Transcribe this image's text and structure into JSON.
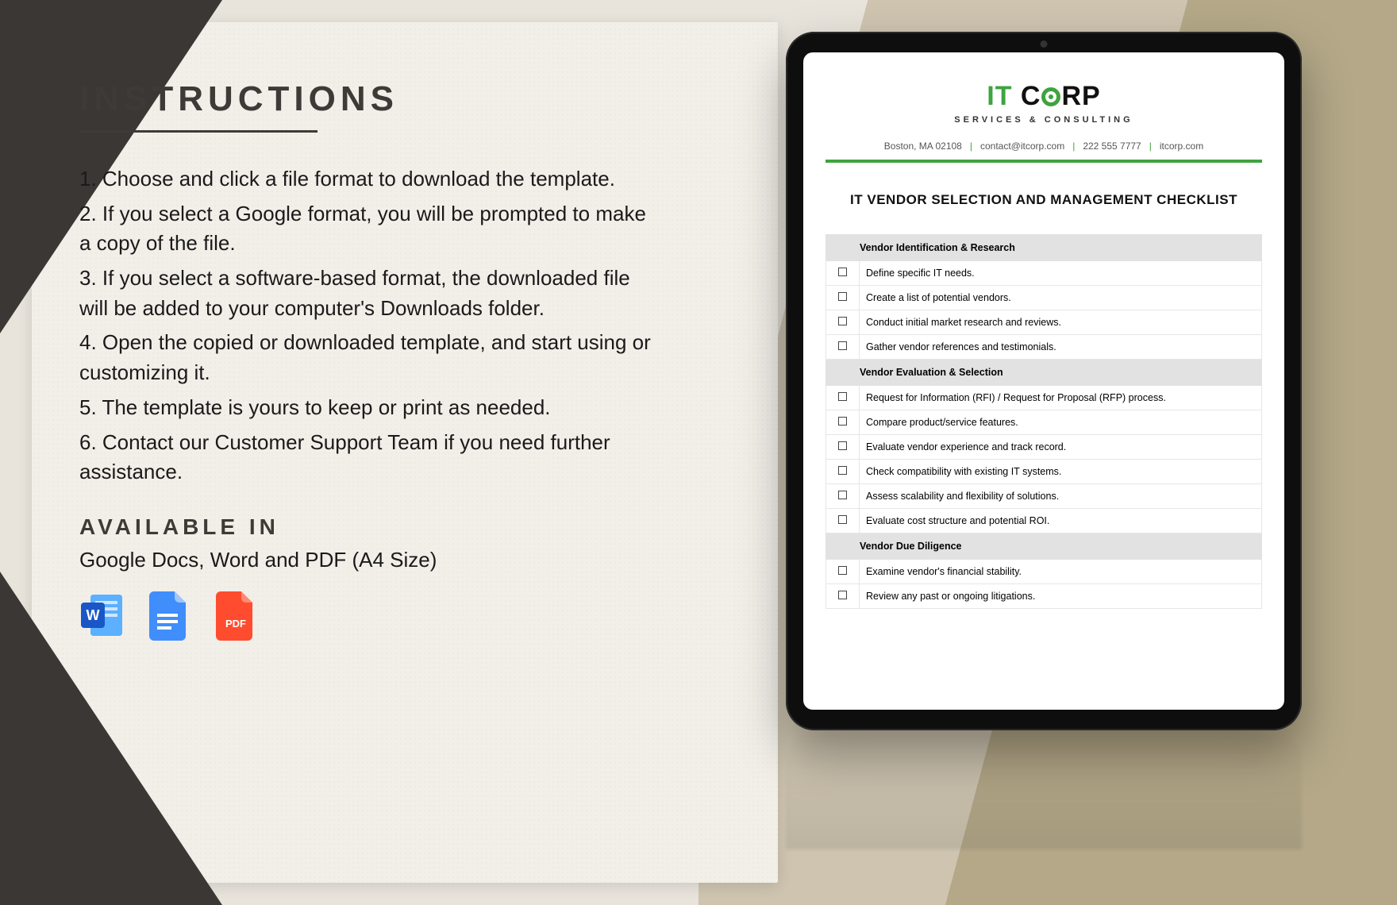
{
  "left": {
    "heading": "INSTRUCTIONS",
    "steps": [
      "1. Choose and click a file format to download the template.",
      "2. If you select a Google format, you will be prompted to make a copy of the file.",
      "3. If you select a software-based format, the downloaded file will be added to your computer's Downloads folder.",
      "4. Open the copied or downloaded template, and start using or customizing it.",
      "5. The template is yours to keep or print as needed.",
      "6. Contact our Customer Support Team if you need further assistance."
    ],
    "available_heading": "AVAILABLE IN",
    "available_text": "Google Docs, Word and PDF (A4 Size)",
    "pdf_label": "PDF"
  },
  "doc": {
    "brand_it": "IT",
    "brand_corp": "CORP",
    "tagline": "SERVICES & CONSULTING",
    "contact_city": "Boston, MA 02108",
    "contact_email": "contact@itcorp.com",
    "contact_phone": "222 555 7777",
    "contact_site": "itcorp.com",
    "title": "IT VENDOR SELECTION AND MANAGEMENT CHECKLIST",
    "sections": [
      {
        "name": "Vendor Identification & Research",
        "items": [
          "Define specific IT needs.",
          "Create a list of potential vendors.",
          "Conduct initial market research and reviews.",
          "Gather vendor references and testimonials."
        ]
      },
      {
        "name": "Vendor Evaluation & Selection",
        "items": [
          "Request for Information (RFI) / Request for Proposal (RFP) process.",
          "Compare product/service features.",
          "Evaluate vendor experience and track record.",
          "Check compatibility with existing IT systems.",
          "Assess scalability and flexibility of solutions.",
          "Evaluate cost structure and potential ROI."
        ]
      },
      {
        "name": "Vendor Due Diligence",
        "items": [
          "Examine vendor's financial stability.",
          "Review any past or ongoing litigations."
        ]
      }
    ]
  }
}
